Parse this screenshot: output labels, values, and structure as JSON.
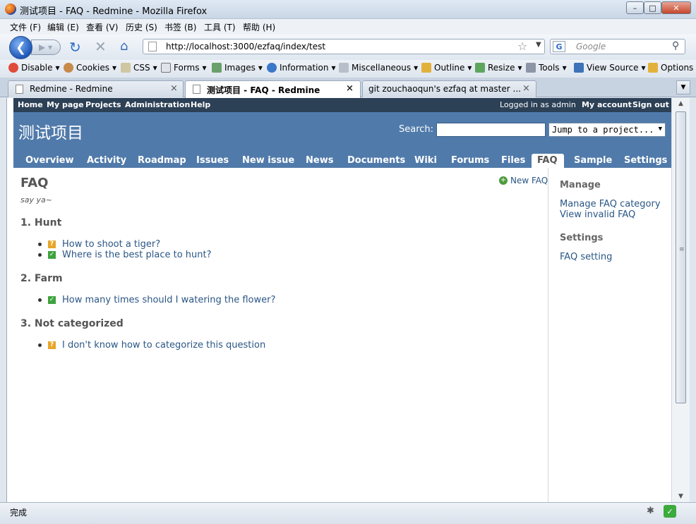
{
  "window": {
    "title": "测试项目 - FAQ - Redmine - Mozilla Firefox",
    "minimize": "–",
    "maximize": "□",
    "close": "✕"
  },
  "menubar": [
    "文件 (F)",
    "编辑 (E)",
    "查看 (V)",
    "历史 (S)",
    "书签 (B)",
    "工具 (T)",
    "帮助 (H)"
  ],
  "navigation": {
    "url": "http://localhost:3000/ezfaq/index/test",
    "search_placeholder": "Google",
    "search_engine": "G",
    "icons": [
      "back-icon",
      "forward-icon",
      "reload-icon",
      "stop-icon",
      "home-icon",
      "star-icon",
      "search-icon"
    ]
  },
  "webdev_toolbar": [
    "Disable",
    "Cookies",
    "CSS",
    "Forms",
    "Images",
    "Information",
    "Miscellaneous",
    "Outline",
    "Resize",
    "Tools",
    "View Source",
    "Options"
  ],
  "tabs": [
    {
      "label": "Redmine - Redmine",
      "active": false
    },
    {
      "label": "测试项目 - FAQ - Redmine",
      "active": true
    },
    {
      "label": "git zouchaoqun's ezfaq at master ...",
      "active": false
    }
  ],
  "redmine": {
    "top_left": [
      "Home",
      "My page",
      "Projects",
      "Administration",
      "Help"
    ],
    "logged_as": "Logged in as admin",
    "top_right": [
      "My account",
      "Sign out"
    ],
    "project_title": "测试项目",
    "search_label": "Search:",
    "jump_to": "Jump to a project...",
    "main_menu": [
      "Overview",
      "Activity",
      "Roadmap",
      "Issues",
      "New issue",
      "News",
      "Documents",
      "Wiki",
      "Forums",
      "Files",
      "FAQ",
      "Sample",
      "Settings"
    ],
    "selected_menu": "FAQ",
    "content": {
      "heading": "FAQ",
      "description": "say ya~",
      "new_faq": "New FAQ",
      "categories": [
        {
          "title": "1. Hunt",
          "items": [
            {
              "text": "How to shoot a tiger?",
              "status": "unanswered"
            },
            {
              "text": "Where is the best place to hunt?",
              "status": "answered"
            }
          ]
        },
        {
          "title": "2. Farm",
          "items": [
            {
              "text": "How many times should I watering the flower?",
              "status": "answered"
            }
          ]
        },
        {
          "title": "3. Not categorized",
          "items": [
            {
              "text": "I don't know how to categorize this question",
              "status": "unanswered"
            }
          ]
        }
      ]
    },
    "sidebar": {
      "manage_heading": "Manage",
      "manage_links": [
        "Manage FAQ category",
        "View invalid FAQ"
      ],
      "settings_heading": "Settings",
      "settings_links": [
        "FAQ setting"
      ]
    }
  },
  "status": "完成",
  "colors": {
    "topmenu_bg": "#2c4056",
    "header_bg": "#507aaa",
    "link": "#2a5685",
    "answered": "#3fa33f",
    "unanswered": "#e8a628"
  }
}
